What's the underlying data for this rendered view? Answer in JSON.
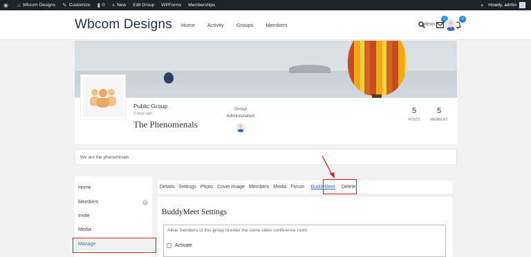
{
  "adminbar": {
    "items": [
      "Wbcom Designs",
      "Customize",
      "0",
      "New",
      "Edit Group",
      "WPForms",
      "Memberships"
    ],
    "howdy": "Howdy, admin"
  },
  "header": {
    "logo": "Wbcom Designs",
    "nav": [
      "Home",
      "Activity",
      "Groups",
      "Members"
    ],
    "messages_count": "0",
    "notifications_count": "0",
    "user": "admin"
  },
  "group": {
    "type": "Public Group",
    "last_active": "3 days ago",
    "name": "The Phenomenals",
    "admins_label_1": "Group",
    "admins_label_2": "Administrators",
    "posts_count": "5",
    "posts_label": "POSTS",
    "members_count": "5",
    "members_label": "MEMBERS",
    "description": "We are the phenominals"
  },
  "sidebar": {
    "items": [
      {
        "label": "Home"
      },
      {
        "label": "Members",
        "count": "5"
      },
      {
        "label": "Invite"
      },
      {
        "label": "Media"
      },
      {
        "label": "Manage"
      }
    ]
  },
  "tabs": [
    "Details",
    "Settings",
    "Photo",
    "Cover Image",
    "Members",
    "Media",
    "Forum",
    "BuddyMeet",
    "Delete"
  ],
  "settings": {
    "title": "BuddyMeet Settings",
    "description": "Allow members of this group to enter the same video conference room.",
    "activate_label": "Activate"
  },
  "colors": {
    "accent": "#3a66c4",
    "highlight": "#e31b1b",
    "badge": "#1e88e5"
  }
}
